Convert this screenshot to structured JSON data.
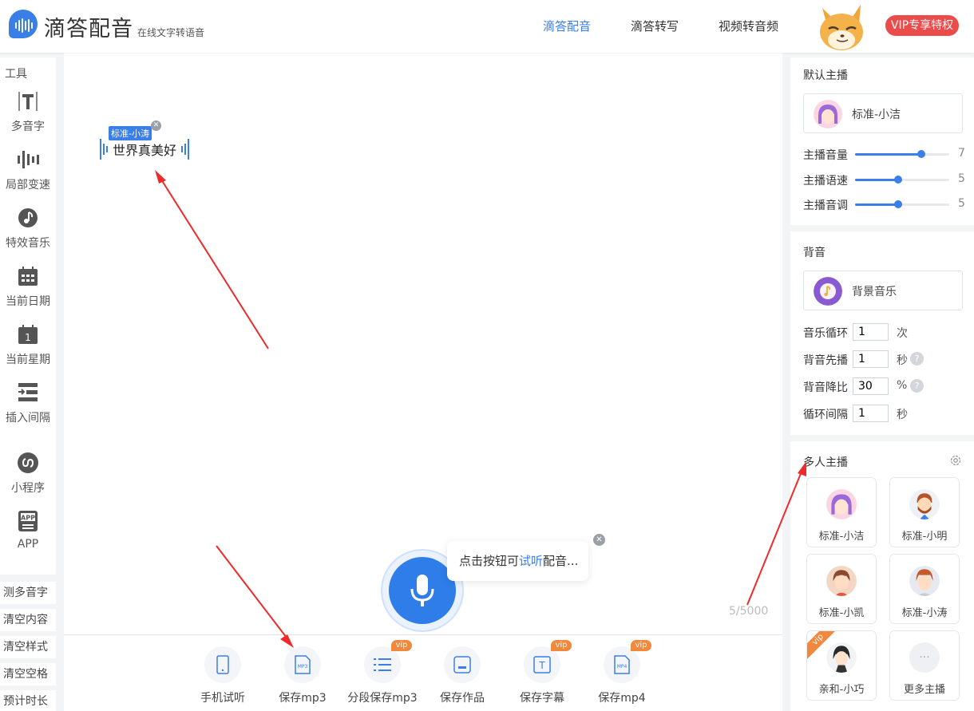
{
  "app": {
    "title": "滴答配音",
    "subtitle": "在线文字转语音"
  },
  "nav": {
    "items": [
      "滴答配音",
      "滴答转写",
      "视频转音频"
    ],
    "active": 0,
    "vip": "VIP专享特权"
  },
  "tools": {
    "title": "工具",
    "items": [
      {
        "label": "多音字",
        "icon": "text-t-icon"
      },
      {
        "label": "局部变速",
        "icon": "sound-wave-icon"
      },
      {
        "label": "特效音乐",
        "icon": "music-note-icon"
      },
      {
        "label": "当前日期",
        "icon": "calendar-icon"
      },
      {
        "label": "当前星期",
        "icon": "calendar-week-icon"
      },
      {
        "label": "插入间隔",
        "icon": "insert-gap-icon"
      },
      {
        "label": "小程序",
        "icon": "miniprogram-icon"
      },
      {
        "label": "APP",
        "icon": "app-icon"
      }
    ],
    "app_icon_text": "APP",
    "side_buttons": [
      "测多音字",
      "清空内容",
      "清空样式",
      "清空空格",
      "预计时长"
    ]
  },
  "editor": {
    "speaker_tag": "标准-小涛",
    "text": "世界真美好",
    "counter": "5/5000",
    "tip": {
      "prefix": "点击按钮可",
      "link": "试听",
      "suffix": "配音..."
    },
    "close_glyph": "✕",
    "actions": [
      {
        "label": "手机试听",
        "icon": "phone-icon",
        "vip": false
      },
      {
        "label": "保存mp3",
        "icon": "mp3-file-icon",
        "vip": false,
        "icon_text": "MP3"
      },
      {
        "label": "分段保存mp3",
        "icon": "list-icon",
        "vip": true
      },
      {
        "label": "保存作品",
        "icon": "save-icon",
        "vip": false
      },
      {
        "label": "保存字幕",
        "icon": "subtitle-icon",
        "vip": true,
        "icon_text": "T"
      },
      {
        "label": "保存mp4",
        "icon": "mp4-file-icon",
        "vip": true,
        "icon_text": "MP4"
      }
    ],
    "vip_label": "vip"
  },
  "right": {
    "default_anchor": {
      "title": "默认主播",
      "name": "标准-小洁",
      "sliders": [
        {
          "label": "主播音量",
          "value": 7,
          "fraction": 0.7
        },
        {
          "label": "主播语速",
          "value": 5,
          "fraction": 0.46
        },
        {
          "label": "主播音调",
          "value": 5,
          "fraction": 0.46
        }
      ]
    },
    "bgm": {
      "title": "背音",
      "name": "背景音乐",
      "rows": [
        {
          "label": "音乐循环",
          "value": "1",
          "unit": "次",
          "help": false
        },
        {
          "label": "背音先播",
          "value": "1",
          "unit": "秒",
          "help": true
        },
        {
          "label": "背音降比",
          "value": "30",
          "unit": "%",
          "help": true
        },
        {
          "label": "循环间隔",
          "value": "1",
          "unit": "秒",
          "help": false
        }
      ],
      "help_glyph": "?"
    },
    "multi": {
      "title": "多人主播",
      "anchors": [
        {
          "name": "标准-小洁",
          "avatar": "girl-avatar",
          "vip": false
        },
        {
          "name": "标准-小明",
          "avatar": "man-beard-avatar",
          "vip": false
        },
        {
          "name": "标准-小凯",
          "avatar": "boy-avatar",
          "vip": false
        },
        {
          "name": "标准-小涛",
          "avatar": "boy2-avatar",
          "vip": false
        },
        {
          "name": "亲和-小巧",
          "avatar": "girl2-avatar",
          "vip": true
        },
        {
          "name": "更多主播",
          "avatar": "more-icon",
          "vip": false
        }
      ],
      "more_glyph": "···",
      "vip_label": "vip"
    }
  },
  "colors": {
    "accent": "#3a7ee8",
    "vip": "#ec4b4b",
    "vip_tag": "#f0883e",
    "arrow": "#ee2a2a"
  }
}
